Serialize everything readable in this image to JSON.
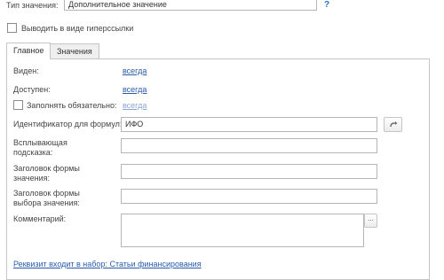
{
  "header": {
    "value_type_label": "Тип значения:",
    "value_type_value": "Дополнительное значение",
    "help_mark": "?",
    "hyperlink_checkbox_label": "Выводить в виде гиперссылки",
    "hyperlink_checked": false
  },
  "tabs": [
    {
      "label": "Главное",
      "active": true
    },
    {
      "label": "Значения",
      "active": false
    }
  ],
  "main": {
    "visible_label": "Виден:",
    "visible_link": "всегда",
    "available_label": "Доступен:",
    "available_link": "всегда",
    "required_label": "Заполнять обязательно:",
    "required_link": "всегда",
    "required_checked": false,
    "formula_id_label": "Идентификатор для формул:",
    "formula_id_value": "ИФО",
    "tooltip_label": "Всплывающая подсказка:",
    "tooltip_value": "",
    "value_form_title_label": "Заголовок формы значения:",
    "value_form_title_value": "",
    "choice_form_title_label": "Заголовок формы выбора значения:",
    "choice_form_title_value": "",
    "comment_label": "Комментарий:",
    "comment_value": "",
    "comment_button": "...",
    "set_membership_link": "Реквизит входит в набор: Статьи финансирования"
  },
  "colors": {
    "link": "#2a5cab",
    "help_mark": "#1f74c8",
    "panel_border": "#c5c5c5"
  },
  "icons": {
    "refresh_button": "arrow-curve-icon"
  }
}
